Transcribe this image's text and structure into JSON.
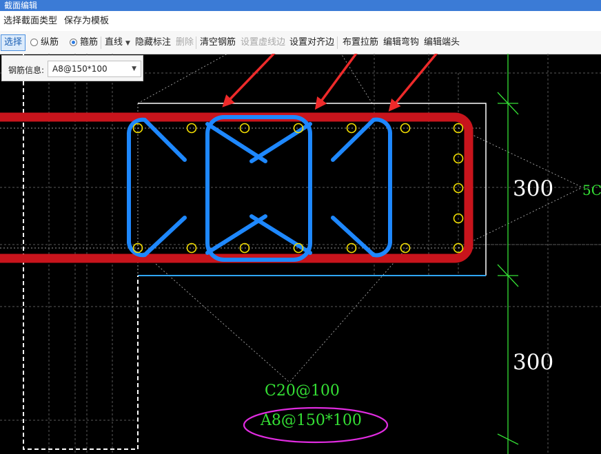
{
  "window": {
    "title": "截面编辑"
  },
  "menu": {
    "items": [
      "选择截面类型",
      "保存为模板"
    ]
  },
  "toolbar": {
    "select": "选择",
    "radio_longitudinal": "纵筋",
    "radio_stirrup": "箍筋",
    "line_mode": "直线",
    "hide_label": "隐藏标注",
    "delete": "删除",
    "clear_rebar": "清空钢筋",
    "set_virtual_edge": "设置虚线边",
    "set_align_edge": "设置对齐边",
    "place_tie": "布置拉筋",
    "edit_hook": "编辑弯钩",
    "edit_end": "编辑端头"
  },
  "rebar_info": {
    "label": "钢筋信息:",
    "value": "A8@150*100"
  },
  "drawing": {
    "dim_top": "300",
    "dim_bottom": "300",
    "dim_right_partial": "5C",
    "tie_label": "C20@100",
    "stirrup_label": "A8@150*100",
    "colors": {
      "background": "#000000",
      "stirrup_red": "#c8141c",
      "tie_blue": "#1e88ff",
      "rebar_dot": "#f5e000",
      "dimension_green": "#35e035",
      "arrow_red": "#ee2a2a",
      "highlight_magenta": "#e02ce0",
      "outline_white": "#ffffff"
    }
  }
}
